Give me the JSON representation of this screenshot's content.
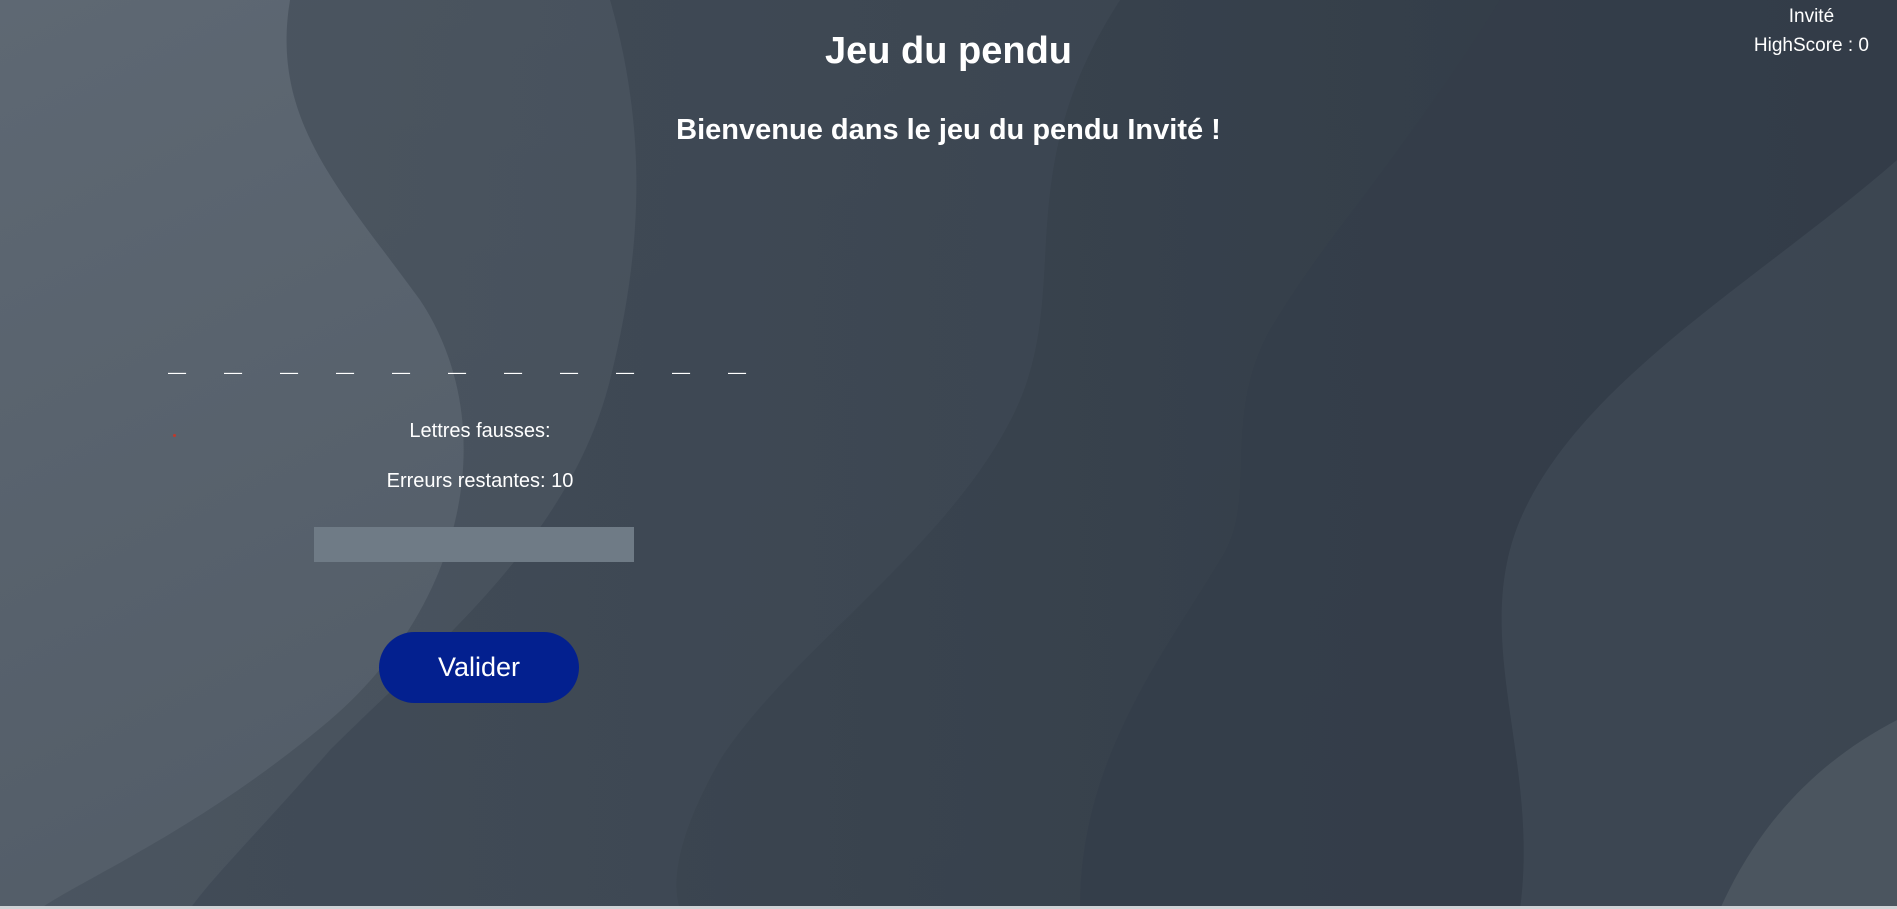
{
  "header": {
    "title": "Jeu du pendu"
  },
  "user": {
    "name": "Invité",
    "highscore_label": "HighScore : 0"
  },
  "welcome": {
    "text": "Bienvenue dans le jeu du pendu Invité !"
  },
  "game": {
    "hidden_word": [
      "_",
      "_",
      "_",
      "_",
      "_",
      "_",
      "_",
      "_",
      "_",
      "_",
      "_"
    ],
    "wrong_letters_label": "Lettres fausses:",
    "remaining_errors_label": "Erreurs restantes: 10",
    "remaining_errors": 10,
    "letter_input": {
      "value": "",
      "placeholder": ""
    },
    "validate_label": "Valider"
  },
  "colors": {
    "background": "#3a4450",
    "button": "#03208f",
    "input": "#6f7b86",
    "text": "#ffffff",
    "error_dot": "#c0392b"
  }
}
